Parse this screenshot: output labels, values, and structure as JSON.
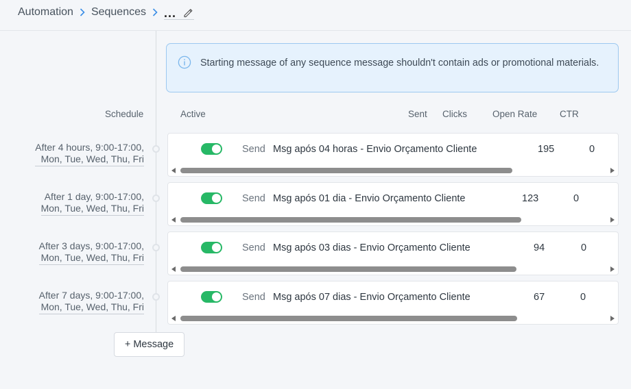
{
  "breadcrumb": {
    "items": [
      "Automation",
      "Sequences"
    ],
    "current": "..."
  },
  "banner": {
    "icon": "info-icon",
    "text": "Starting message of any sequence message shouldn't contain ads or promotional materials."
  },
  "columns": {
    "schedule": "Schedule",
    "active": "Active",
    "sent": "Sent",
    "clicks": "Clicks",
    "open_rate": "Open Rate",
    "ctr": "CTR"
  },
  "messages": [
    {
      "schedule_line1": "After 4 hours, 9:00-17:00,",
      "schedule_line2": "Mon, Tue, Wed, Thu, Fri",
      "active": true,
      "action": "Send",
      "name": "Msg após 04 horas - Envio Orçamento Cliente",
      "sent": "195",
      "clicks": "0"
    },
    {
      "schedule_line1": "After 1 day, 9:00-17:00,",
      "schedule_line2": "Mon, Tue, Wed, Thu, Fri",
      "active": true,
      "action": "Send",
      "name": "Msg após 01 dia - Envio Orçamento Cliente",
      "sent": "123",
      "clicks": "0"
    },
    {
      "schedule_line1": "After 3 days, 9:00-17:00,",
      "schedule_line2": "Mon, Tue, Wed, Thu, Fri",
      "active": true,
      "action": "Send",
      "name": "Msg após 03 dias - Envio Orçamento Cliente",
      "sent": "94",
      "clicks": "0"
    },
    {
      "schedule_line1": "After 7 days, 9:00-17:00,",
      "schedule_line2": "Mon, Tue, Wed, Thu, Fri",
      "active": true,
      "action": "Send",
      "name": "Msg após 07 dias - Envio Orçamento Cliente",
      "sent": "67",
      "clicks": "0"
    }
  ],
  "add_message_label": "+ Message",
  "colors": {
    "accent": "#3a8ee6",
    "toggle_on": "#27b866",
    "banner_bg": "#e6f2fd",
    "banner_border": "#9cc8f0"
  }
}
